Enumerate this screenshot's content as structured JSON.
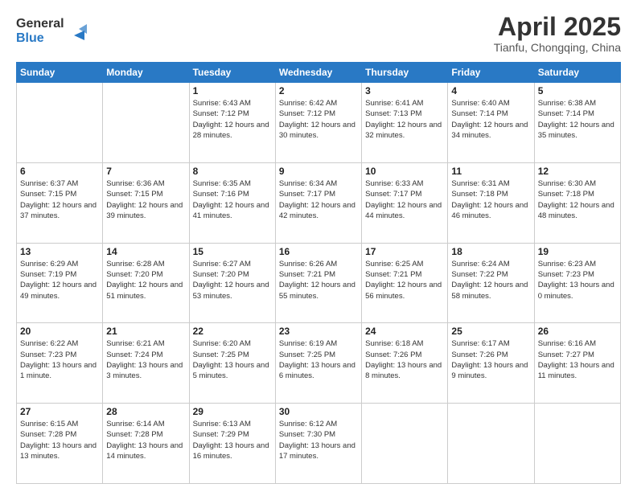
{
  "header": {
    "logo_line1": "General",
    "logo_line2": "Blue",
    "month_year": "April 2025",
    "location": "Tianfu, Chongqing, China"
  },
  "days_of_week": [
    "Sunday",
    "Monday",
    "Tuesday",
    "Wednesday",
    "Thursday",
    "Friday",
    "Saturday"
  ],
  "weeks": [
    [
      {
        "day": "",
        "info": ""
      },
      {
        "day": "",
        "info": ""
      },
      {
        "day": "1",
        "info": "Sunrise: 6:43 AM\nSunset: 7:12 PM\nDaylight: 12 hours\nand 28 minutes."
      },
      {
        "day": "2",
        "info": "Sunrise: 6:42 AM\nSunset: 7:12 PM\nDaylight: 12 hours\nand 30 minutes."
      },
      {
        "day": "3",
        "info": "Sunrise: 6:41 AM\nSunset: 7:13 PM\nDaylight: 12 hours\nand 32 minutes."
      },
      {
        "day": "4",
        "info": "Sunrise: 6:40 AM\nSunset: 7:14 PM\nDaylight: 12 hours\nand 34 minutes."
      },
      {
        "day": "5",
        "info": "Sunrise: 6:38 AM\nSunset: 7:14 PM\nDaylight: 12 hours\nand 35 minutes."
      }
    ],
    [
      {
        "day": "6",
        "info": "Sunrise: 6:37 AM\nSunset: 7:15 PM\nDaylight: 12 hours\nand 37 minutes."
      },
      {
        "day": "7",
        "info": "Sunrise: 6:36 AM\nSunset: 7:15 PM\nDaylight: 12 hours\nand 39 minutes."
      },
      {
        "day": "8",
        "info": "Sunrise: 6:35 AM\nSunset: 7:16 PM\nDaylight: 12 hours\nand 41 minutes."
      },
      {
        "day": "9",
        "info": "Sunrise: 6:34 AM\nSunset: 7:17 PM\nDaylight: 12 hours\nand 42 minutes."
      },
      {
        "day": "10",
        "info": "Sunrise: 6:33 AM\nSunset: 7:17 PM\nDaylight: 12 hours\nand 44 minutes."
      },
      {
        "day": "11",
        "info": "Sunrise: 6:31 AM\nSunset: 7:18 PM\nDaylight: 12 hours\nand 46 minutes."
      },
      {
        "day": "12",
        "info": "Sunrise: 6:30 AM\nSunset: 7:18 PM\nDaylight: 12 hours\nand 48 minutes."
      }
    ],
    [
      {
        "day": "13",
        "info": "Sunrise: 6:29 AM\nSunset: 7:19 PM\nDaylight: 12 hours\nand 49 minutes."
      },
      {
        "day": "14",
        "info": "Sunrise: 6:28 AM\nSunset: 7:20 PM\nDaylight: 12 hours\nand 51 minutes."
      },
      {
        "day": "15",
        "info": "Sunrise: 6:27 AM\nSunset: 7:20 PM\nDaylight: 12 hours\nand 53 minutes."
      },
      {
        "day": "16",
        "info": "Sunrise: 6:26 AM\nSunset: 7:21 PM\nDaylight: 12 hours\nand 55 minutes."
      },
      {
        "day": "17",
        "info": "Sunrise: 6:25 AM\nSunset: 7:21 PM\nDaylight: 12 hours\nand 56 minutes."
      },
      {
        "day": "18",
        "info": "Sunrise: 6:24 AM\nSunset: 7:22 PM\nDaylight: 12 hours\nand 58 minutes."
      },
      {
        "day": "19",
        "info": "Sunrise: 6:23 AM\nSunset: 7:23 PM\nDaylight: 13 hours\nand 0 minutes."
      }
    ],
    [
      {
        "day": "20",
        "info": "Sunrise: 6:22 AM\nSunset: 7:23 PM\nDaylight: 13 hours\nand 1 minute."
      },
      {
        "day": "21",
        "info": "Sunrise: 6:21 AM\nSunset: 7:24 PM\nDaylight: 13 hours\nand 3 minutes."
      },
      {
        "day": "22",
        "info": "Sunrise: 6:20 AM\nSunset: 7:25 PM\nDaylight: 13 hours\nand 5 minutes."
      },
      {
        "day": "23",
        "info": "Sunrise: 6:19 AM\nSunset: 7:25 PM\nDaylight: 13 hours\nand 6 minutes."
      },
      {
        "day": "24",
        "info": "Sunrise: 6:18 AM\nSunset: 7:26 PM\nDaylight: 13 hours\nand 8 minutes."
      },
      {
        "day": "25",
        "info": "Sunrise: 6:17 AM\nSunset: 7:26 PM\nDaylight: 13 hours\nand 9 minutes."
      },
      {
        "day": "26",
        "info": "Sunrise: 6:16 AM\nSunset: 7:27 PM\nDaylight: 13 hours\nand 11 minutes."
      }
    ],
    [
      {
        "day": "27",
        "info": "Sunrise: 6:15 AM\nSunset: 7:28 PM\nDaylight: 13 hours\nand 13 minutes."
      },
      {
        "day": "28",
        "info": "Sunrise: 6:14 AM\nSunset: 7:28 PM\nDaylight: 13 hours\nand 14 minutes."
      },
      {
        "day": "29",
        "info": "Sunrise: 6:13 AM\nSunset: 7:29 PM\nDaylight: 13 hours\nand 16 minutes."
      },
      {
        "day": "30",
        "info": "Sunrise: 6:12 AM\nSunset: 7:30 PM\nDaylight: 13 hours\nand 17 minutes."
      },
      {
        "day": "",
        "info": ""
      },
      {
        "day": "",
        "info": ""
      },
      {
        "day": "",
        "info": ""
      }
    ]
  ]
}
